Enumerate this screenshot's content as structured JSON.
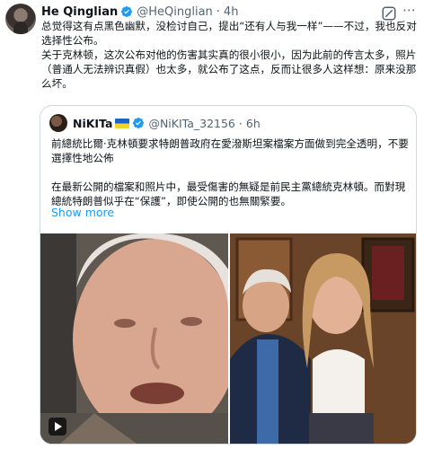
{
  "author": {
    "name": "He Qinglian",
    "handle": "@HeQinglian",
    "separator": "·",
    "time": "4h",
    "verified": true
  },
  "post": {
    "paragraphs": [
      "总觉得这有点黑色幽默，没检讨自己，提出“还有人与我一样”——不过，我也反对选择性公布。",
      "关于克林顿，这次公布对他的伤害其实真的很小很小，因为此前的传言太多，照片（普通人无法辨识真假）也太多，就公布了这点，反而让很多人这样想：原来没那么坏。"
    ]
  },
  "quoted": {
    "name": "NiKITa",
    "flag": "ukraine-flag",
    "verified": true,
    "handle": "@NiKITa_32156",
    "separator": "·",
    "time": "6h",
    "paragraphs": [
      "前總統比爾·克林頓要求特朗普政府在愛潑斯坦案檔案方面做到完全透明，不要選擇性地公佈",
      "在最新公開的檔案和照片中，最受傷害的無疑是前民主黨總統克林頓。而對現總統特朗普似乎在“保護”，即使公開的也無關緊要。"
    ],
    "show_more": "Show more"
  },
  "colors": {
    "link": "#1d9bf0",
    "verified": "#1d9bf0",
    "secondary_text": "#536471",
    "border": "#cfd9de"
  }
}
